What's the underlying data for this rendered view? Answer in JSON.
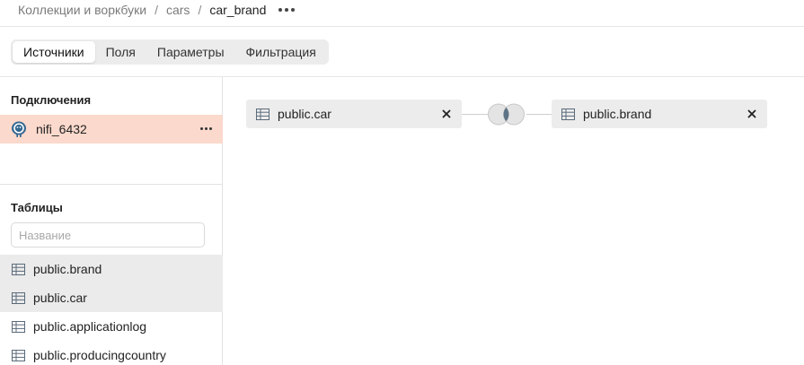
{
  "breadcrumb": {
    "items": [
      "Коллекции и воркбуки",
      "cars",
      "car_brand"
    ],
    "separator": "/"
  },
  "tabs": [
    {
      "label": "Источники",
      "active": true
    },
    {
      "label": "Поля",
      "active": false
    },
    {
      "label": "Параметры",
      "active": false
    },
    {
      "label": "Фильтрация",
      "active": false
    }
  ],
  "sidebar": {
    "connections_title": "Подключения",
    "connection": {
      "label": "nifi_6432",
      "icon": "postgresql-icon"
    },
    "tables_title": "Таблицы",
    "search_placeholder": "Название",
    "search_value": "",
    "tables": [
      {
        "label": "public.brand",
        "selected": true
      },
      {
        "label": "public.car",
        "selected": true
      },
      {
        "label": "public.applicationlog",
        "selected": false
      },
      {
        "label": "public.producingcountry",
        "selected": false
      }
    ]
  },
  "canvas": {
    "left_source": {
      "label": "public.car"
    },
    "right_source": {
      "label": "public.brand"
    },
    "join_type": "inner-join-icon"
  },
  "colors": {
    "accent_selection": "#fbd9cc",
    "selected_row": "#ebebeb",
    "node_bg": "#ececec",
    "join_overlap": "#5f7386"
  }
}
